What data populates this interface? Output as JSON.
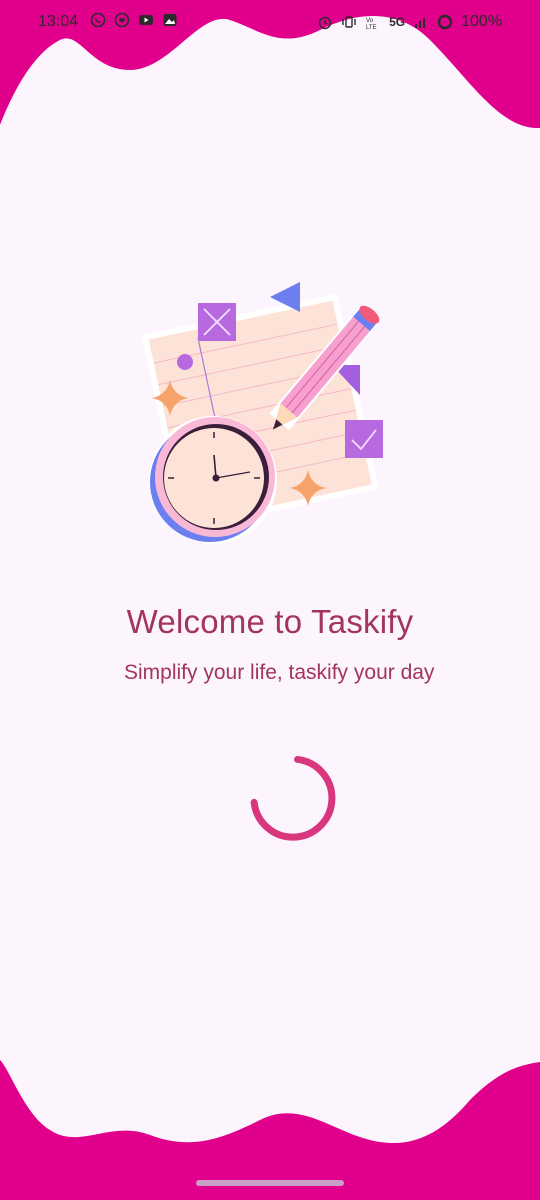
{
  "status_bar": {
    "time": "13:04",
    "left_icons": [
      "whatsapp-icon",
      "heart-icon",
      "youtube-icon",
      "gallery-icon"
    ],
    "right_icons": [
      "alarm-icon",
      "vibrate-icon",
      "volte-icon",
      "signal-icon",
      "battery-icon"
    ],
    "network": "5G",
    "battery": "100%"
  },
  "splash": {
    "title": "Welcome to Taskify",
    "subtitle": "Simplify your life, taskify your day",
    "illustration": "task-clock-pencil-illustration",
    "loading": "spinner"
  },
  "colors": {
    "accent": "#e1008c",
    "background": "#fcf5fd",
    "text": "#a3345f",
    "spinner": "#d8367d"
  }
}
